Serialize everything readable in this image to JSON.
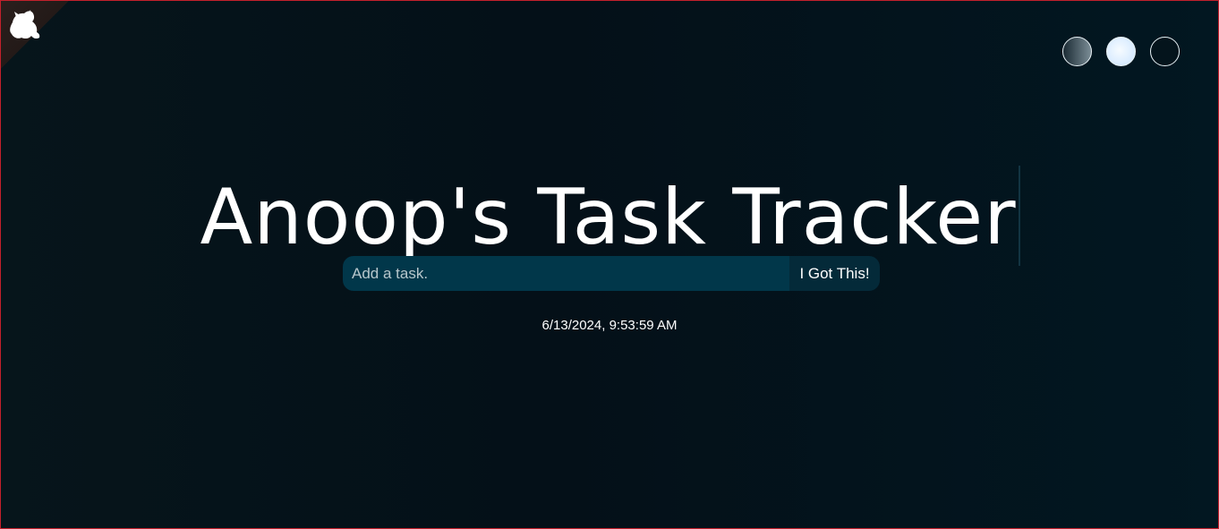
{
  "header": {
    "title": "Anoop's Task Tracker",
    "corner_icon": "cat-icon"
  },
  "themes": [
    {
      "name": "standard",
      "color": "#1b2b34"
    },
    {
      "name": "light",
      "color": "#e6f3ff"
    },
    {
      "name": "darker",
      "color": "#04141c"
    }
  ],
  "task_form": {
    "placeholder": "Add a task.",
    "value": "",
    "button_label": "I Got This!"
  },
  "status": {
    "datetime": "6/13/2024, 9:53:59 AM"
  },
  "colors": {
    "background": "#041018",
    "input_background": "#01374a",
    "button_background": "#042a39",
    "text": "#ffffff",
    "border": "#c3202c"
  }
}
